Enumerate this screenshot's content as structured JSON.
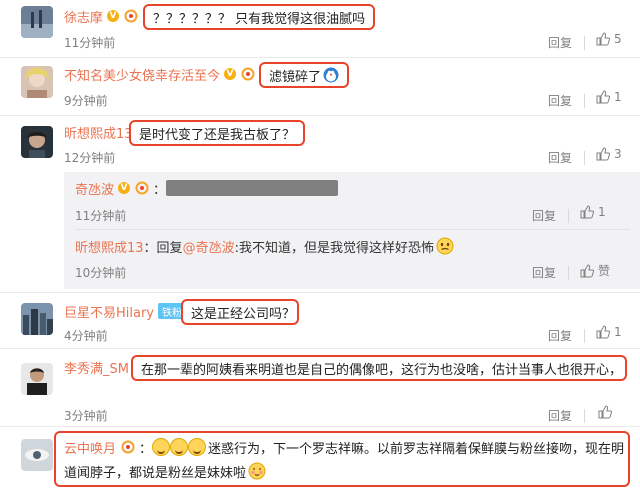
{
  "labels": {
    "reply": "回复",
    "like": "赞",
    "fans": "铁粉"
  },
  "comments": [
    {
      "user": "徐志摩",
      "text": "？？？？？？ 只有我觉得这很油腻吗",
      "time": "11分钟前",
      "likes": "5"
    },
    {
      "user": "不知名美少女侥幸存活至今",
      "text": "滤镜碎了",
      "time": "9分钟前",
      "likes": "1"
    },
    {
      "user": "昕想熙成13",
      "text": "是时代变了还是我古板了？",
      "time": "12分钟前",
      "likes": "3"
    },
    {
      "user": "巨星不易Hilary",
      "text": "这是正经公司吗？",
      "time": "4分钟前",
      "likes": "1"
    },
    {
      "user": "李秀满_SM",
      "text": "在那一辈的阿姨看来明道也是自己的偶像吧，这行为也没啥，估计当事人也很开心，",
      "time": "3分钟前",
      "likes": ""
    },
    {
      "user": "云中唤月",
      "text_line1": "迷惑行为，下一个罗志祥嘛。以前罗志祥隔着保鲜膜与粉丝接吻，现在明",
      "text_line2": "道闻脖子，都说是粉丝是妹妹啦"
    }
  ],
  "replies": [
    {
      "user": "奇氹波",
      "time": "11分钟前",
      "likes": "1"
    },
    {
      "user": "昕想熙成13",
      "prefix": "：回复",
      "mention": "@奇氹波",
      "text": ":我不知道，但是我觉得这样好恐怖",
      "time": "10分钟前"
    }
  ],
  "colors": {
    "accent": "#eb7350",
    "highlight": "#e8442c",
    "muted": "#808080"
  }
}
